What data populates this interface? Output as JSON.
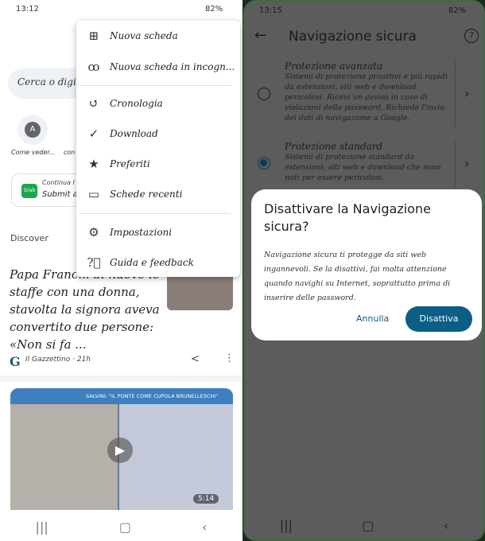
{
  "left": {
    "status": {
      "time": "13:12",
      "battery": "82%"
    },
    "search_placeholder": "Cerca o digit",
    "shortcuts": [
      {
        "letter": "A",
        "label": "Come veder..."
      },
      {
        "label": "con"
      }
    ],
    "continue_card": {
      "title": "Continua l",
      "subtitle": "Submit a",
      "app_badge": "Grab"
    },
    "discover": "Discover",
    "menu": [
      {
        "icon": "plus-box-icon",
        "label": "Nuova scheda"
      },
      {
        "icon": "incognito-icon",
        "label": "Nuova scheda in incogn..."
      },
      {
        "icon": "history-icon",
        "label": "Cronologia"
      },
      {
        "icon": "download-icon",
        "label": "Download"
      },
      {
        "icon": "star-icon",
        "label": "Preferiti"
      },
      {
        "icon": "devices-icon",
        "label": "Schede recenti"
      },
      {
        "icon": "gear-icon",
        "label": "Impostazioni"
      },
      {
        "icon": "help-icon",
        "label": "Guida e feedback"
      }
    ],
    "article": {
      "title": "Papa Franc... di nuovo le staffe con una donna, stavolta la signora aveva convertito due persone: «Non si fa ...",
      "source": "Il Gazzettino · 21h"
    },
    "video": {
      "banner": "SALVINI: \"IL PONTE COME CUPOLA BRUNELLESCHI\"",
      "duration": "5:14"
    }
  },
  "right": {
    "status": {
      "time": "13:15",
      "battery": "82%"
    },
    "title": "Navigazione sicura",
    "options": [
      {
        "title": "Protezione avanzata",
        "desc": "Sistemi di protezione proattivi e più rapidi da estensioni, siti web e download pericolosi. Ricevi un avviso in caso di violazioni della password. Richiede l'invio dei dati di navigazione a Google.",
        "selected": false
      },
      {
        "title": "Protezione standard",
        "desc": "Sistemi di protezione standard da estensioni, siti web e download che sono noti per essere pericolosi.",
        "selected": true
      }
    ],
    "dialog": {
      "title": "Disattivare la Navigazione sicura?",
      "body": "Navigazione sicura ti protegge da siti web ingannevoli. Se la disattivi, fai molta attenzione quando navighi su Internet, soprattutto prima di inserire delle password.",
      "cancel": "Annulla",
      "confirm": "Disattiva"
    },
    "accent": "#0b5e85"
  }
}
